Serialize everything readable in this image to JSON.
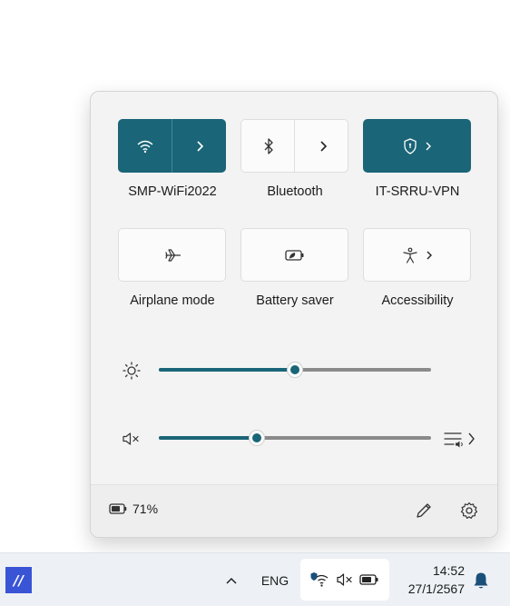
{
  "quick_settings": {
    "tiles": [
      {
        "label": "SMP-WiFi2022",
        "state": "on",
        "icon": "wifi-icon",
        "has_chevron": true
      },
      {
        "label": "Bluetooth",
        "state": "off",
        "icon": "bluetooth-icon",
        "has_chevron": true
      },
      {
        "label": "IT-SRRU-VPN",
        "state": "on",
        "icon": "vpn-shield-icon",
        "has_chevron": true
      },
      {
        "label": "Airplane mode",
        "state": "off",
        "icon": "airplane-icon",
        "has_chevron": false
      },
      {
        "label": "Battery saver",
        "state": "off",
        "icon": "battery-saver-icon",
        "has_chevron": false
      },
      {
        "label": "Accessibility",
        "state": "off",
        "icon": "accessibility-icon",
        "has_chevron": true
      }
    ],
    "brightness": {
      "icon": "brightness-icon",
      "value_percent": 50
    },
    "volume": {
      "icon": "volume-muted-icon",
      "value_percent": 36,
      "muted": true,
      "mixer_icon": "sound-output-icon"
    },
    "battery": {
      "percent_label": "71%",
      "icon": "battery-icon"
    },
    "edit_icon": "pencil-icon",
    "settings_icon": "gear-icon"
  },
  "taskbar": {
    "app_icon": "app-logo-icon",
    "overflow_icon": "chevron-up-icon",
    "language": "ENG",
    "tray_icons": [
      "vpn-wifi-icon",
      "volume-muted-icon",
      "battery-icon"
    ],
    "time": "14:52",
    "date": "27/1/2567",
    "notification_icon": "bell-icon"
  },
  "colors": {
    "accent": "#1a6577",
    "panel_bg": "#f3f3f3",
    "taskbar_bg": "#edf1f5"
  }
}
